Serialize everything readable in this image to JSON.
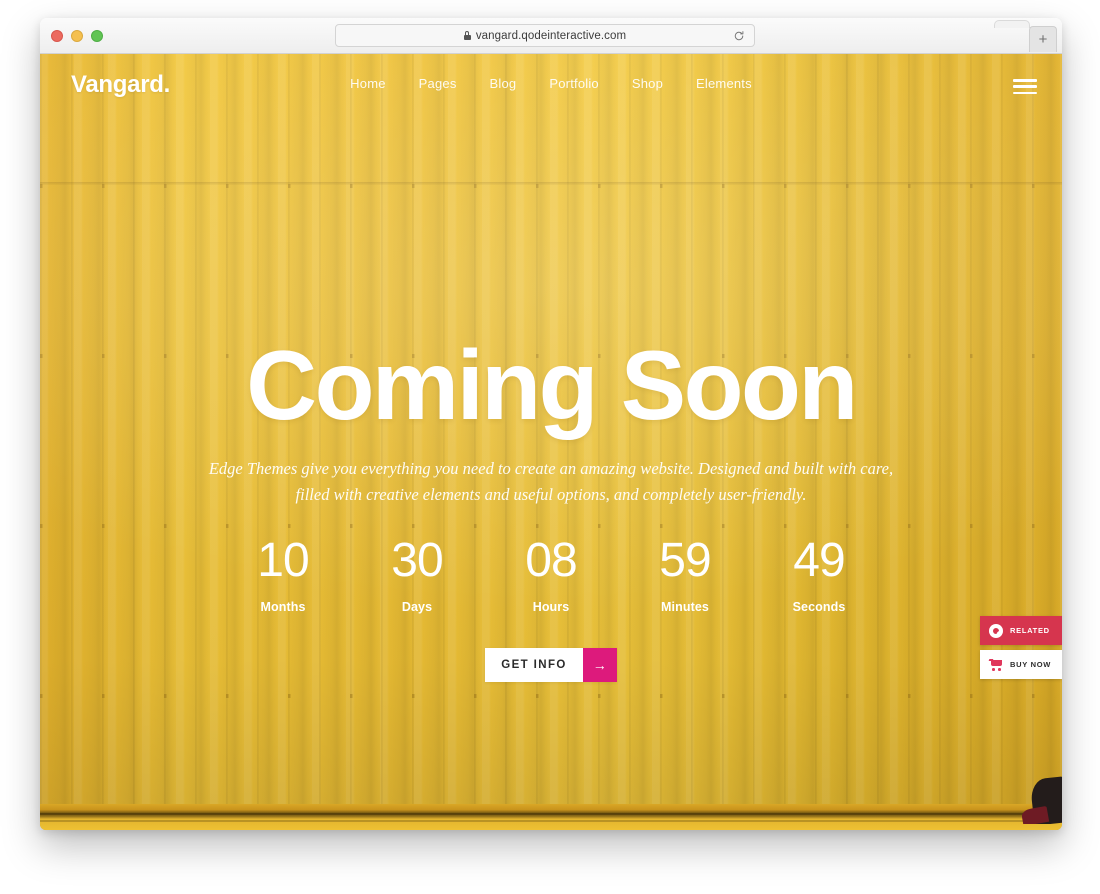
{
  "browser": {
    "url": "vangard.qodeinteractive.com",
    "lock_icon": "lock-icon",
    "reload_icon": "reload-icon",
    "newtab_label": "+",
    "traffic_lights": [
      "close-red",
      "minimize-yellow",
      "maximize-green"
    ]
  },
  "site": {
    "logo": "Vangard.",
    "nav": [
      {
        "label": "Home"
      },
      {
        "label": "Pages"
      },
      {
        "label": "Blog"
      },
      {
        "label": "Portfolio"
      },
      {
        "label": "Shop"
      },
      {
        "label": "Elements"
      }
    ],
    "menu_icon": "hamburger-icon"
  },
  "hero": {
    "headline": "Coming Soon",
    "subtitle": "Edge Themes give you everything you need to create an amazing website. Designed and built with care, filled with creative elements and useful options, and completely user-friendly.",
    "countdown": [
      {
        "value": "10",
        "label": "Months"
      },
      {
        "value": "30",
        "label": "Days"
      },
      {
        "value": "08",
        "label": "Hours"
      },
      {
        "value": "59",
        "label": "Minutes"
      },
      {
        "value": "49",
        "label": "Seconds"
      }
    ],
    "cta": {
      "label": "GET INFO",
      "arrow": "→"
    }
  },
  "side_widgets": [
    {
      "label": "RELATED",
      "icon": "qode-logo-icon"
    },
    {
      "label": "BUY NOW",
      "icon": "cart-icon"
    }
  ],
  "colors": {
    "background_yellow": "#f0c02f",
    "accent_pink": "#dd1a7c",
    "related_red": "#d6354e",
    "cart_pink": "#e0365c",
    "text_white": "#ffffff"
  }
}
